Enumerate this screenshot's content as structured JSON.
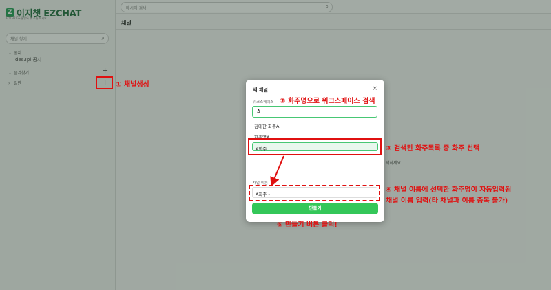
{
  "app": {
    "logo_mark": "Z",
    "logo_name": "이지챗 EZCHAT",
    "logo_sub": "FOTHRIGS 물류와 주 소통 하시요"
  },
  "sidebar": {
    "search_placeholder": "채널 찾기",
    "sections": [
      {
        "label": "공지",
        "items": [
          "des3pl 공지"
        ]
      },
      {
        "label": "즐겨찾기"
      },
      {
        "label": "일반"
      }
    ],
    "plus": "+"
  },
  "topbar": {
    "search_placeholder": "메시지 검색"
  },
  "channel": {
    "title": "채널",
    "hint": "택하세요."
  },
  "modal": {
    "title": "새 채널",
    "close": "×",
    "workspace_label": "워크스페이스",
    "workspace_value": "A",
    "results": [
      "김대한 화주A",
      "화주명A"
    ],
    "selected_result": "A화주",
    "name_label": "채널 이름",
    "name_value": "A화주 -",
    "create_label": "만들기"
  },
  "annotations": {
    "a1": "① 채널생성",
    "a2": "② 화주명으로 워크스페이스 검색",
    "a3": "③ 검색된 화주목록 중 화주 선택",
    "a4_line1": "④ 채널 이름에 선택한 화주명이 자동입력됨",
    "a4_line2": "채널 이름 입력(타 채널과 이름 중복 불가)",
    "a5": "⑤ 만들기 버튼 클릭!"
  },
  "colors": {
    "accent": "#34c759",
    "annotation": "#e01010",
    "logo": "#1e6b3d"
  }
}
